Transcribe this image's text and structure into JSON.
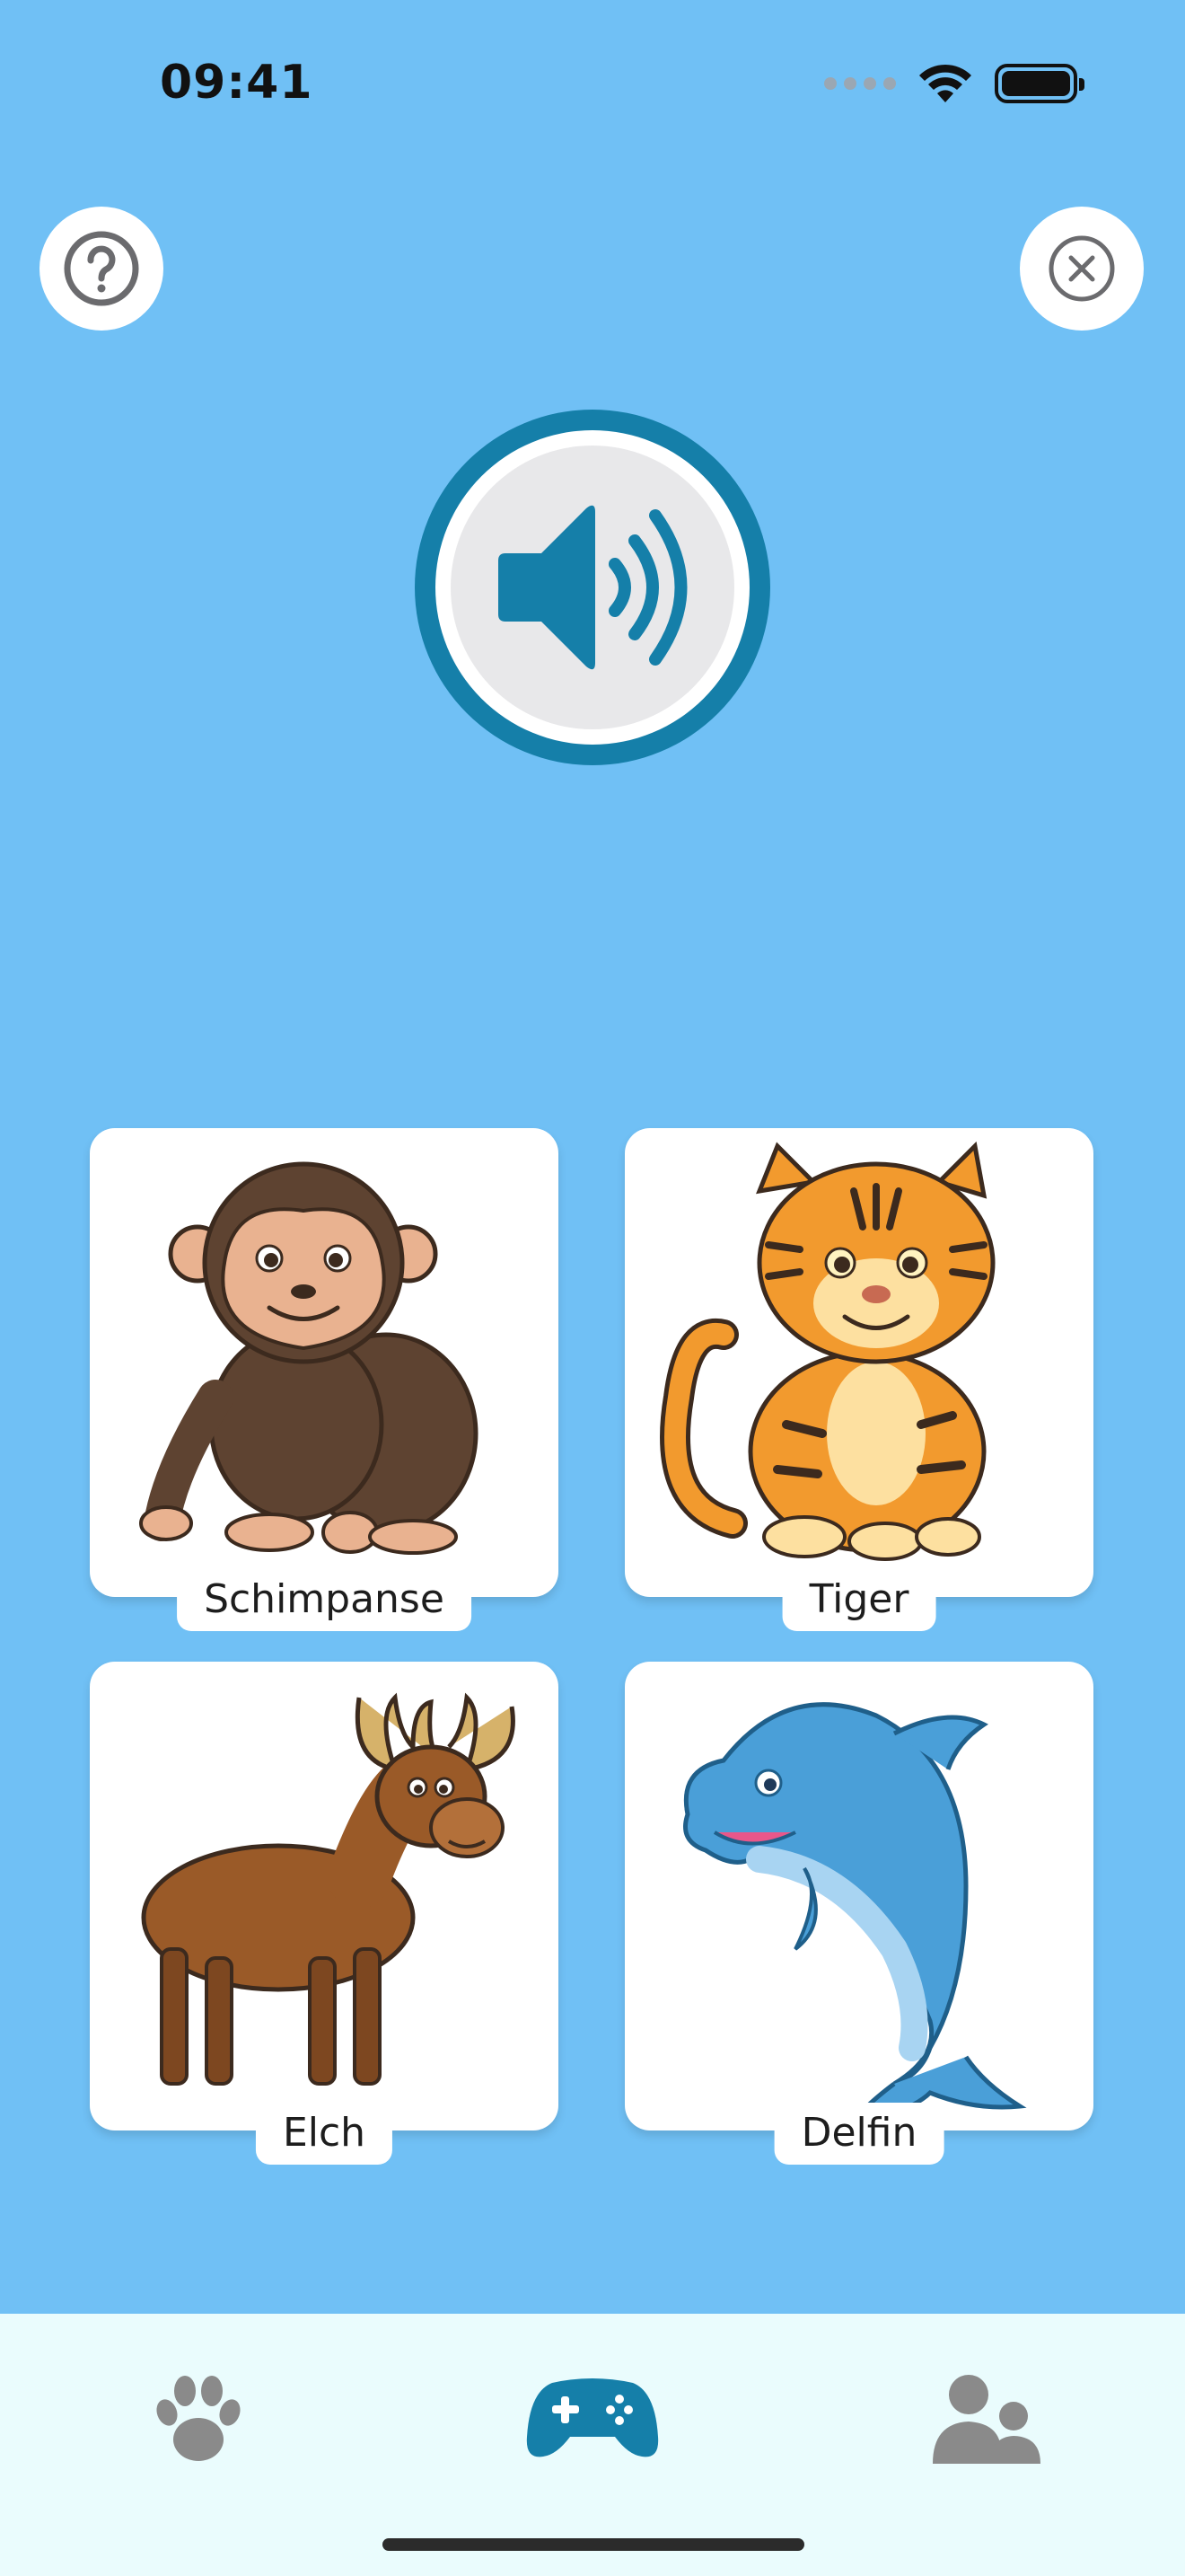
{
  "status_bar": {
    "time": "09:41"
  },
  "header": {
    "help_icon": "question-circle-icon",
    "close_icon": "x-circle-icon"
  },
  "speaker": {
    "icon": "speaker-wave-icon",
    "color": "#157FA9"
  },
  "cards": [
    {
      "label": "Schimpanse",
      "icon": "chimpanzee"
    },
    {
      "label": "Tiger",
      "icon": "tiger"
    },
    {
      "label": "Elch",
      "icon": "moose"
    },
    {
      "label": "Delfin",
      "icon": "dolphin"
    }
  ],
  "tab_bar": {
    "items": [
      {
        "icon": "paw-icon",
        "active": false
      },
      {
        "icon": "gamepad-icon",
        "active": true
      },
      {
        "icon": "people-icon",
        "active": false
      }
    ],
    "active_color": "#157FA9",
    "inactive_color": "#8a8a8a"
  },
  "colors": {
    "background": "#70C0F5",
    "tab_bar_background": "#EAFCFD"
  }
}
